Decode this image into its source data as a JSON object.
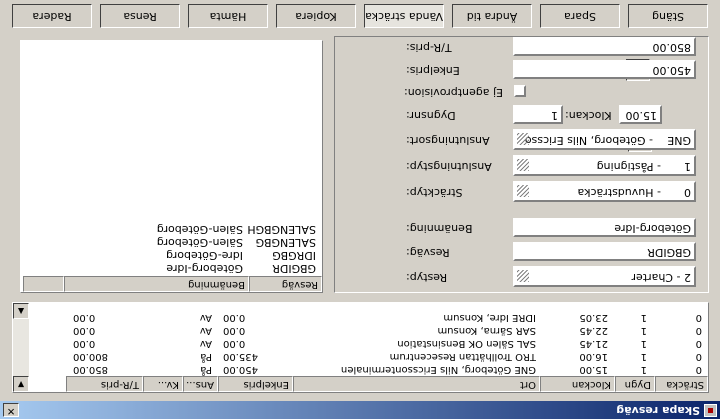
{
  "window": {
    "title": "Skapa resväg"
  },
  "trip_table": {
    "columns": [
      "Sträcka",
      "Dygn",
      "Klockan",
      "Ort",
      "Enkelpris",
      "Ans...",
      "Kv...",
      "T/R-pris"
    ],
    "rows": [
      [
        "0",
        "1",
        "15.00",
        "GNE Göteborg, Nils Ericssonterminalen",
        "450.00",
        "På",
        "",
        "850.00"
      ],
      [
        "0",
        "1",
        "16.00",
        "TRO Trollhättan Resecentrum",
        "435.00",
        "På",
        "",
        "800.00"
      ],
      [
        "0",
        "1",
        "21.45",
        "SAL Sälen OK Bensinstation",
        "0.00",
        "Av",
        "",
        "0.00"
      ],
      [
        "0",
        "1",
        "22.45",
        "SAR Särna, Konsum",
        "0.00",
        "Av",
        "",
        "0.00"
      ],
      [
        "0",
        "1",
        "23.05",
        "IDRE Idre, Konsum",
        "0.00",
        "Av",
        "",
        "0.00"
      ]
    ]
  },
  "route_list": {
    "columns": [
      "Resväg",
      "Benämning"
    ],
    "rows": [
      [
        "GBGIDR",
        "Göteborg-Idre"
      ],
      [
        "IDRGBG",
        "Idre-Göteborg"
      ],
      [
        "SALENGBG",
        "Sälen-Göteborg"
      ],
      [
        "SALENGBGH",
        "Sälen-Göteborg"
      ]
    ]
  },
  "form": {
    "restyp": {
      "label": "Restyp:",
      "value": "2 - Charter"
    },
    "resvag": {
      "label": "Resväg:",
      "value": "GBGIDR"
    },
    "benamning": {
      "label": "Benämning:",
      "value": "Göteborg-Idre"
    },
    "strackyp": {
      "label": "Sträcktyp:",
      "value": "0",
      "text": "- Huvudsträcka"
    },
    "anslutningstyp": {
      "label": "Anslutningstyp:",
      "value": "1",
      "text": "- Påstigning"
    },
    "anslutningsort": {
      "label": "Anslutningsort:",
      "value": "GNE",
      "text": "- Göteborg, Nils Ericsso"
    },
    "dygnsnr": {
      "label": "Dygnsnr:",
      "value": "1"
    },
    "klockan": {
      "label": "Klockan:",
      "value": "15.00"
    },
    "ej_agentprovision": {
      "label": "Ej agentprovision:"
    },
    "enkelpris": {
      "label": "Enkelpris:",
      "value": "450.00"
    },
    "tr_pris": {
      "label": "T/R-pris:",
      "value": "850.00"
    }
  },
  "tabs": [
    "Radera",
    "Rensa",
    "Hämta",
    "Kopiera",
    "Vända sträcka",
    "Ändra tid",
    "Spara",
    "Stäng"
  ],
  "active_tab": "Vända sträcka"
}
